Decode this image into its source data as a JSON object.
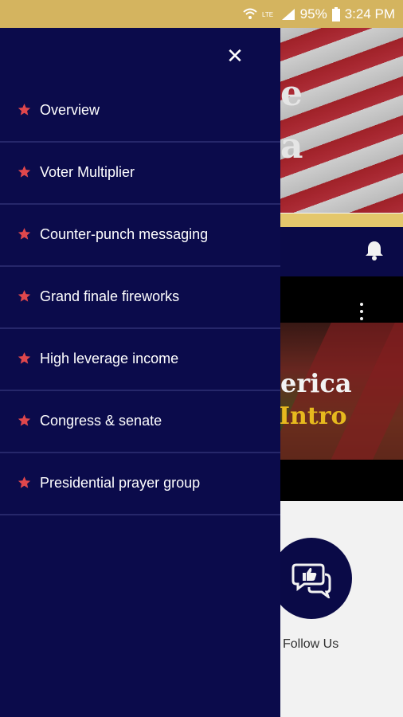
{
  "status_bar": {
    "battery": "95%",
    "time": "3:24 PM",
    "icons": [
      "wifi-icon",
      "volte-icon",
      "signal-icon",
      "battery-icon"
    ]
  },
  "drawer": {
    "close_icon": "close-icon",
    "items": [
      {
        "label": "Overview",
        "icon": "star-icon"
      },
      {
        "label": "Voter Multiplier",
        "icon": "star-icon"
      },
      {
        "label": "Counter-punch messaging",
        "icon": "star-icon"
      },
      {
        "label": "Grand finale fireworks",
        "icon": "star-icon"
      },
      {
        "label": "High leverage income",
        "icon": "star-icon"
      },
      {
        "label": "Congress & senate",
        "icon": "star-icon"
      },
      {
        "label": "Presidential prayer group",
        "icon": "star-icon"
      }
    ]
  },
  "background": {
    "banner_partial_letters": [
      "e",
      "a"
    ],
    "video_title_partial": "erica",
    "video_subtitle_partial": "Intro",
    "follow_label": "Follow Us"
  },
  "colors": {
    "navy": "#0b0b4b",
    "gold": "#d4b45f",
    "star_red": "#e0474c",
    "divider": "#26276a"
  }
}
